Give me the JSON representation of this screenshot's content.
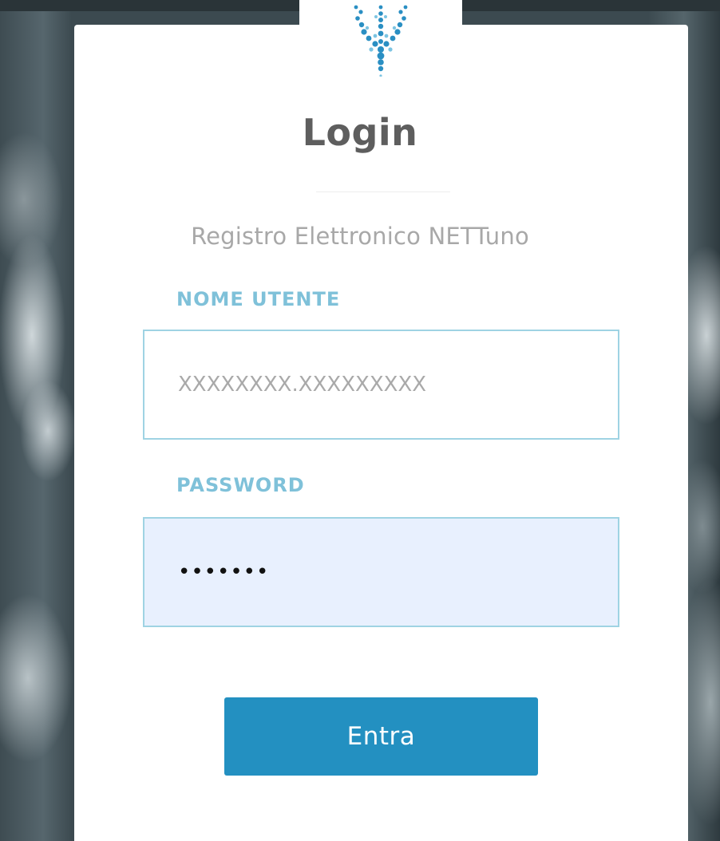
{
  "login": {
    "title": "Login",
    "subtitle": "Registro Elettronico NETTuno",
    "username_label": "NOME UTENTE",
    "username_placeholder": "XXXXXXXX.XXXXXXXXX",
    "password_label": "PASSWORD",
    "password_value": "•••••••",
    "submit_label": "Entra"
  },
  "icons": {
    "logo": "trident-logo-icon"
  },
  "colors": {
    "button": "#2390c1",
    "label": "#7fc1d9",
    "input_border": "#9fd3e3",
    "password_fill": "#e8f0fe",
    "title": "#5e5e5e",
    "subtitle": "#a8a8a8"
  }
}
